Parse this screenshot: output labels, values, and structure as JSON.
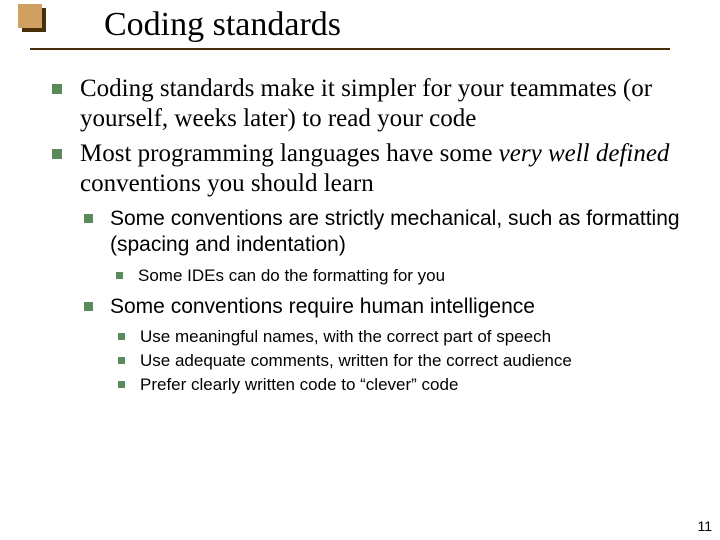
{
  "title": "Coding standards",
  "page_number": "11",
  "bullets": {
    "b1": "Coding standards make it simpler for your teammates (or yourself, weeks later) to read your code",
    "b2a": "Most programming languages have some ",
    "b2b": "very well defined",
    "b2c": " conventions you should learn",
    "b2_1": "Some conventions are strictly mechanical, such as formatting (spacing and indentation)",
    "b2_1_1": "Some IDEs can do the formatting for you",
    "b2_2": "Some conventions require human intelligence",
    "b2_2_1": "Use meaningful names, with the correct part of speech",
    "b2_2_2": "Use adequate comments, written for the correct audience",
    "b2_2_3": "Prefer clearly written code to “clever” code"
  }
}
